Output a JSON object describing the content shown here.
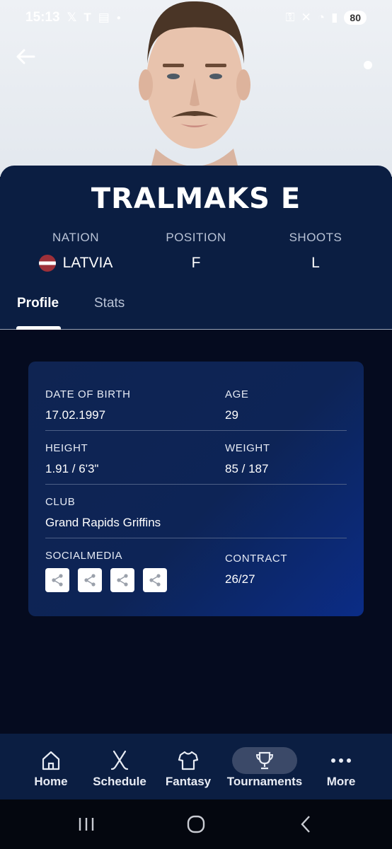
{
  "status_bar": {
    "time": "15:13",
    "battery": "80"
  },
  "player": {
    "name": "TRALMAKS E"
  },
  "meta": [
    {
      "label": "NATION",
      "value": "LATVIA"
    },
    {
      "label": "POSITION",
      "value": "F"
    },
    {
      "label": "SHOOTS",
      "value": "L"
    }
  ],
  "tabs": [
    {
      "label": "Profile",
      "active": true
    },
    {
      "label": "Stats",
      "active": false
    }
  ],
  "profile": {
    "date_of_birth": {
      "label": "DATE OF BIRTH",
      "value": "17.02.1997"
    },
    "age": {
      "label": "AGE",
      "value": "29"
    },
    "height": {
      "label": "HEIGHT",
      "value": "1.91 / 6'3\""
    },
    "weight": {
      "label": "WEIGHT",
      "value": "85 / 187"
    },
    "club": {
      "label": "CLUB",
      "value": "Grand Rapids Griffins"
    },
    "socialmedia": {
      "label": "SOCIALMEDIA"
    },
    "contract": {
      "label": "CONTRACT",
      "value": "26/27"
    }
  },
  "nav": [
    {
      "label": "Home",
      "icon": "home-icon"
    },
    {
      "label": "Schedule",
      "icon": "crossed-sticks-icon"
    },
    {
      "label": "Fantasy",
      "icon": "jersey-icon"
    },
    {
      "label": "Tournaments",
      "icon": "trophy-icon",
      "active": true
    },
    {
      "label": "More",
      "icon": "more-dots-icon"
    }
  ],
  "colors": {
    "header": "#0b1e42",
    "background": "#050b1f",
    "card_accent": "#0b2c86",
    "flag_red": "#9e3039"
  }
}
